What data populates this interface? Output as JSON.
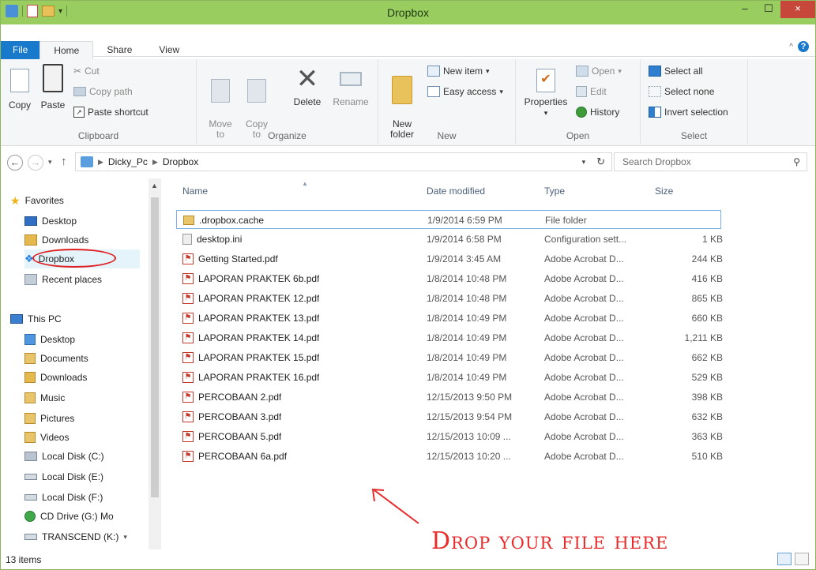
{
  "window": {
    "title": "Dropbox",
    "minimize": "–",
    "maximize": "☐",
    "close": "×"
  },
  "tabs": [
    {
      "label": "File"
    },
    {
      "label": "Home"
    },
    {
      "label": "Share"
    },
    {
      "label": "View"
    }
  ],
  "ribbon": {
    "clipboard": {
      "label": "Clipboard",
      "copy": "Copy",
      "paste": "Paste",
      "cut": "Cut",
      "copy_path": "Copy path",
      "paste_shortcut": "Paste shortcut"
    },
    "organize": {
      "label": "Organize",
      "move_to": "Move\nto",
      "copy_to": "Copy\nto",
      "delete": "Delete",
      "rename": "Rename"
    },
    "new": {
      "label": "New",
      "new_folder": "New\nfolder",
      "new_item": "New item",
      "easy_access": "Easy access"
    },
    "open": {
      "label": "Open",
      "properties": "Properties",
      "open": "Open",
      "edit": "Edit",
      "history": "History"
    },
    "select": {
      "label": "Select",
      "select_all": "Select all",
      "select_none": "Select none",
      "invert_selection": "Invert selection"
    }
  },
  "address": {
    "path": [
      "Dicky_Pc",
      "Dropbox"
    ],
    "search_placeholder": "Search Dropbox"
  },
  "nav": {
    "favorites_label": "Favorites",
    "favorites": [
      "Desktop",
      "Downloads",
      "Dropbox",
      "Recent places"
    ],
    "thispc_label": "This PC",
    "thispc": [
      "Desktop",
      "Documents",
      "Downloads",
      "Music",
      "Pictures",
      "Videos",
      "Local Disk (C:)",
      "Local Disk (E:)",
      "Local Disk (F:)",
      "CD Drive (G:) Mo",
      "TRANSCEND (K:)"
    ]
  },
  "columns": {
    "name": "Name",
    "date": "Date modified",
    "type": "Type",
    "size": "Size"
  },
  "files": [
    {
      "name": ".dropbox.cache",
      "date": "1/9/2014 6:59 PM",
      "type": "File folder",
      "size": ""
    },
    {
      "name": "desktop.ini",
      "date": "1/9/2014 6:58 PM",
      "type": "Configuration sett...",
      "size": "1 KB"
    },
    {
      "name": "Getting Started.pdf",
      "date": "1/9/2014 3:45 AM",
      "type": "Adobe Acrobat D...",
      "size": "244 KB"
    },
    {
      "name": "LAPORAN PRAKTEK 6b.pdf",
      "date": "1/8/2014 10:48 PM",
      "type": "Adobe Acrobat D...",
      "size": "416 KB"
    },
    {
      "name": "LAPORAN PRAKTEK 12.pdf",
      "date": "1/8/2014 10:48 PM",
      "type": "Adobe Acrobat D...",
      "size": "865 KB"
    },
    {
      "name": "LAPORAN PRAKTEK 13.pdf",
      "date": "1/8/2014 10:49 PM",
      "type": "Adobe Acrobat D...",
      "size": "660 KB"
    },
    {
      "name": "LAPORAN PRAKTEK 14.pdf",
      "date": "1/8/2014 10:49 PM",
      "type": "Adobe Acrobat D...",
      "size": "1,211 KB"
    },
    {
      "name": "LAPORAN PRAKTEK 15.pdf",
      "date": "1/8/2014 10:49 PM",
      "type": "Adobe Acrobat D...",
      "size": "662 KB"
    },
    {
      "name": "LAPORAN PRAKTEK 16.pdf",
      "date": "1/8/2014 10:49 PM",
      "type": "Adobe Acrobat D...",
      "size": "529 KB"
    },
    {
      "name": "PERCOBAAN 2.pdf",
      "date": "12/15/2013 9:50 PM",
      "type": "Adobe Acrobat D...",
      "size": "398 KB"
    },
    {
      "name": "PERCOBAAN 3.pdf",
      "date": "12/15/2013 9:54 PM",
      "type": "Adobe Acrobat D...",
      "size": "632 KB"
    },
    {
      "name": "PERCOBAAN 5.pdf",
      "date": "12/15/2013 10:09 ...",
      "type": "Adobe Acrobat D...",
      "size": "363 KB"
    },
    {
      "name": "PERCOBAAN 6a.pdf",
      "date": "12/15/2013 10:20 ...",
      "type": "Adobe Acrobat D...",
      "size": "510 KB"
    }
  ],
  "status": {
    "items": "13 items"
  },
  "annotation": {
    "text": "Drop your file here"
  },
  "colors": {
    "titlebar": "#9acd5f",
    "accent": "#1979ca",
    "annotation": "#e82b2b"
  }
}
